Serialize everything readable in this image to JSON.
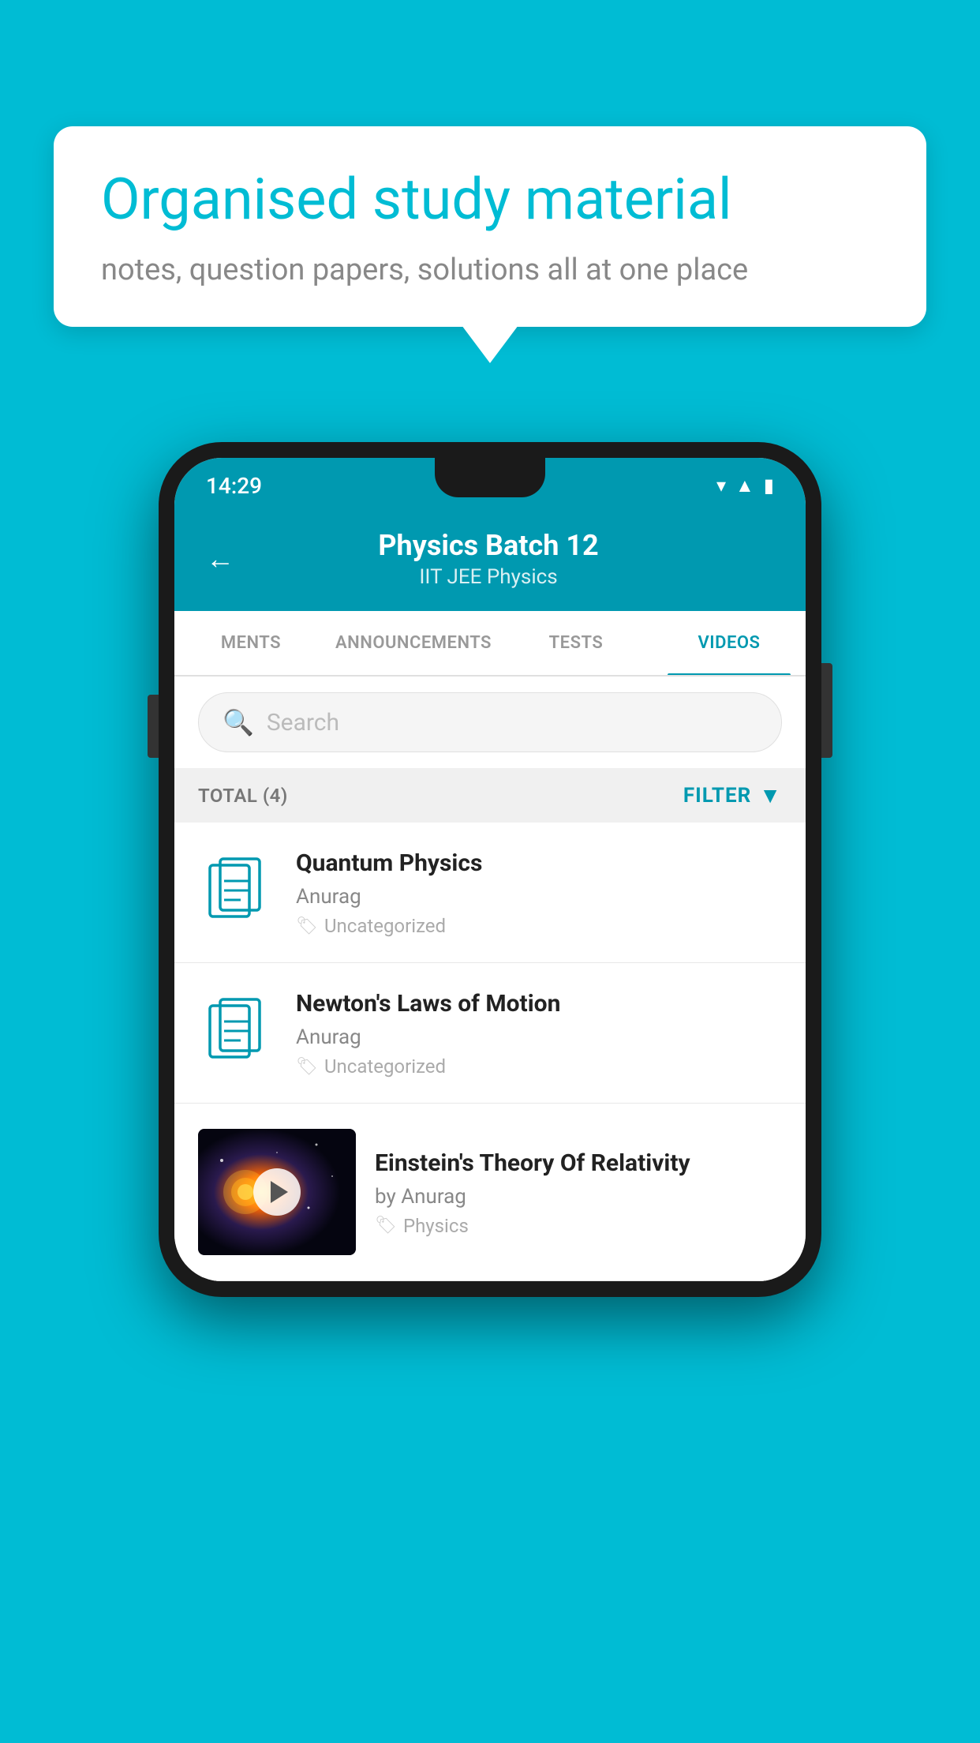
{
  "background": {
    "color": "#00BCD4"
  },
  "bubble": {
    "title": "Organised study material",
    "subtitle": "notes, question papers, solutions all at one place"
  },
  "phone": {
    "statusBar": {
      "time": "14:29",
      "icons": [
        "wifi",
        "signal",
        "battery"
      ]
    },
    "header": {
      "title": "Physics Batch 12",
      "subtitle": "IIT JEE   Physics",
      "backLabel": "←"
    },
    "tabs": [
      {
        "label": "MENTS",
        "active": false
      },
      {
        "label": "ANNOUNCEMENTS",
        "active": false
      },
      {
        "label": "TESTS",
        "active": false
      },
      {
        "label": "VIDEOS",
        "active": true
      }
    ],
    "search": {
      "placeholder": "Search"
    },
    "filterBar": {
      "totalLabel": "TOTAL (4)",
      "filterLabel": "FILTER"
    },
    "videos": [
      {
        "id": 1,
        "title": "Quantum Physics",
        "author": "Anurag",
        "tag": "Uncategorized",
        "hasThumb": false
      },
      {
        "id": 2,
        "title": "Newton's Laws of Motion",
        "author": "Anurag",
        "tag": "Uncategorized",
        "hasThumb": false
      },
      {
        "id": 3,
        "title": "Einstein's Theory Of Relativity",
        "author": "by Anurag",
        "tag": "Physics",
        "hasThumb": true
      }
    ]
  }
}
